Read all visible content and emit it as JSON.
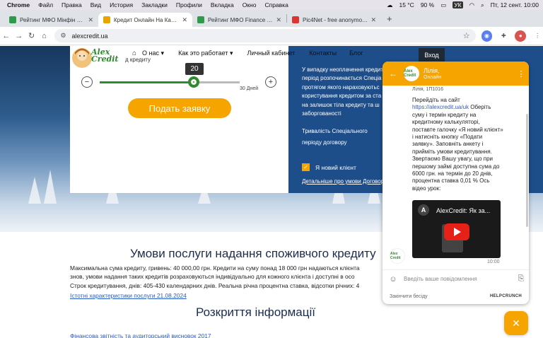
{
  "menubar": {
    "app": "Chrome",
    "items": [
      "Файл",
      "Правка",
      "Вид",
      "История",
      "Закладки",
      "Профили",
      "Вкладка",
      "Окно",
      "Справка"
    ],
    "temperature": "15 °C",
    "battery": "90 %",
    "lang": "УК",
    "clock": "Пт, 12 сент.  10:00"
  },
  "tabs": [
    {
      "title": "Рейтинг МФО Мінфін 2023-",
      "color": "#2e9b4a",
      "active": false
    },
    {
      "title": "Кредит Онлайн На Карту Ук",
      "color": "#e8a400",
      "active": true
    },
    {
      "title": "Рейтинг МФО Finance З кв 2",
      "color": "#2e9b4a",
      "active": false
    },
    {
      "title": "Pic4Net - free anonymous im",
      "color": "#d33",
      "active": false
    }
  ],
  "toolbar": {
    "url": "alexcredit.ua"
  },
  "site": {
    "logo_text": "Alex Credit",
    "nav": [
      "О нас",
      "Как это работает",
      "Личный кабинет",
      "Контакты",
      "Блог"
    ],
    "login": "Вход",
    "calc_label": "д кредиту",
    "slider_value": "20",
    "slider_fraction": 0.67,
    "days_label": "30 Дней",
    "apply": "Подать заявку",
    "info_lines": [
      "У випадку неоплачення кредит",
      "період розпочинається Спеціа",
      "протягом якого нараховуютьс",
      "користування кредитом за ста",
      "на залишок тіла кредиту та ш",
      "заборгованості"
    ],
    "duration_lines": [
      "Тривалість Спеціального",
      "періоду договору"
    ],
    "new_client": "Я новий клієнт",
    "details": "Детальніше про умови Договору",
    "terms_heading": "Умови послуги надання споживчого кредиту",
    "terms_lines": [
      "Максимальна сума кредиту, гривень: 40 000,00 грн. Кредити на суму понад 18 000 грн надаються клієнта",
      "знов, умови надання таких кредитів розраховуються індивідуально для кожного клієнта і доступні в осо",
      "Строк кредитування, днів: 405-430 календарних днів. Реальна річна процентна ставка, відсотки річних: 4"
    ],
    "terms_link": "Істотні характеристики послуги 21.08.2024",
    "disclosure_heading": "Розкриття інформації",
    "report_link": "Фінансова звітність та аудиторський висновок 2017"
  },
  "chat": {
    "agent_name": "Лілія,",
    "agent_status": "Онлайн",
    "avatar_text": "Alex Credit",
    "message_author": "Лілія, 1П1016",
    "message_before_link": "Перейдіть на сайт ",
    "message_link": "https://alexcredit.ua/uk",
    "message_after_link": "  Оберіть суму і термін кредиту на кредитному калькуляторі, поставте галочку «Я новий клієнт» і натисніть кнопку «Подати заявку». Заповніть анкету і прийміть умови кредитування. Звертаємо Вашу увагу, що при першому займі доступна сума до 6000 грн. на термін до 20 днів, процентна ставка 0,01 % Ось відео урок:",
    "video_title": "AlexCredit: Як за...",
    "video_letter": "A",
    "time": "10:00",
    "input_placeholder": "Введіть ваше повідомлення",
    "end_chat": "Закінчити бесіду",
    "brand": "HELPCRUNCH"
  }
}
